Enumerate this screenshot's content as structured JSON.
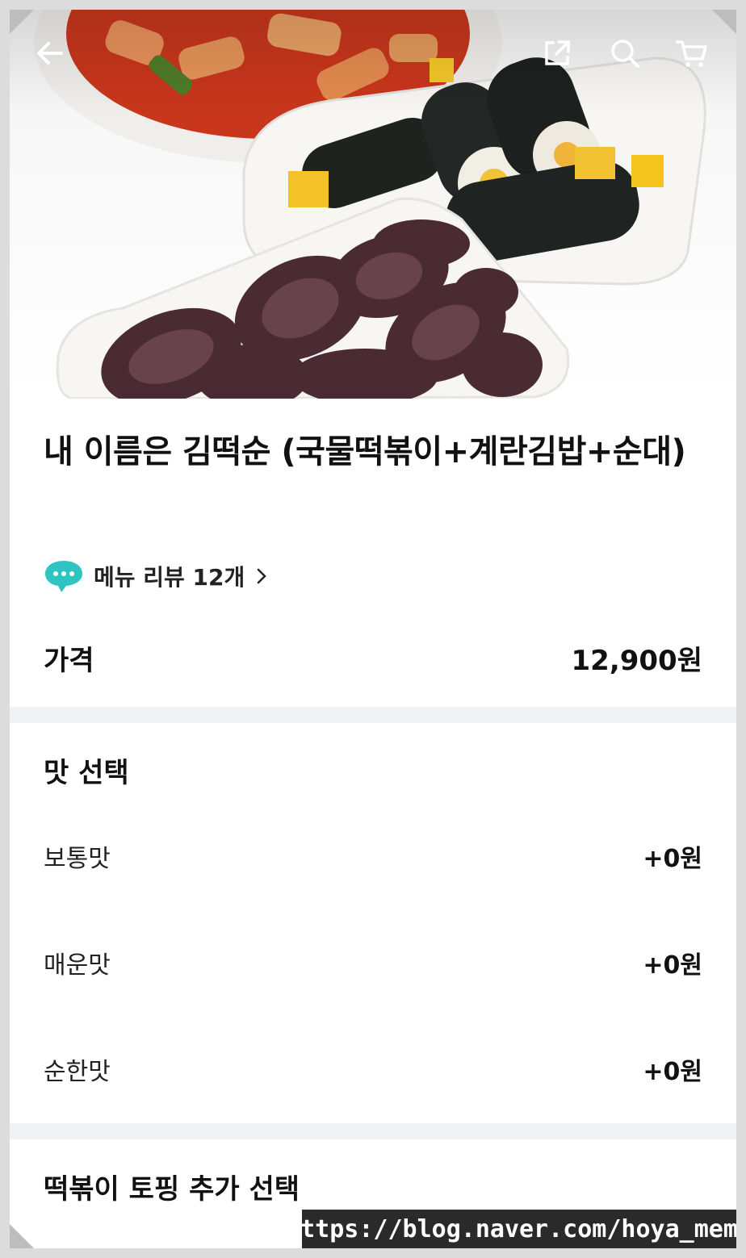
{
  "header": {
    "back_icon": "arrow-left-icon",
    "share_icon": "share-icon",
    "search_icon": "search-icon",
    "cart_icon": "cart-icon"
  },
  "product": {
    "title": "내 이름은 김떡순 (국물떡볶이+계란김밥+순대)",
    "review_link": "메뉴 리뷰 12개",
    "price_label": "가격",
    "price_value": "12,900원"
  },
  "taste_section": {
    "title": "맛 선택",
    "options": [
      {
        "name": "보통맛",
        "price": "+0원"
      },
      {
        "name": "매운맛",
        "price": "+0원"
      },
      {
        "name": "순한맛",
        "price": "+0원"
      }
    ]
  },
  "topping_section": {
    "title": "떡볶이 토핑 추가 선택"
  },
  "watermark": "https://blog.naver.com/hoya_memo",
  "colors": {
    "review_bubble": "#2ec4c4",
    "divider": "#f1f2f4"
  }
}
